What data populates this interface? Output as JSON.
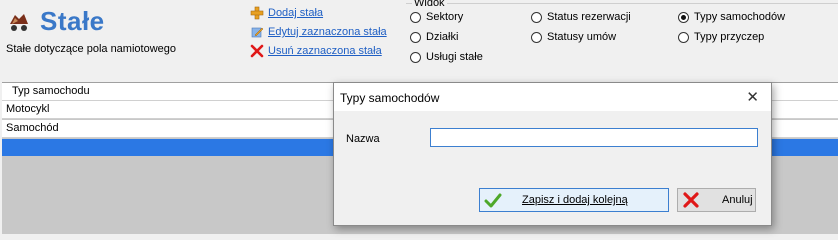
{
  "header": {
    "title": "Stałe",
    "subtitle": "Stałe dotyczące pola namiotowego"
  },
  "actions": {
    "add": "Dodaj stała",
    "edit": "Edytuj zaznaczona stała",
    "delete": "Usuń zaznaczona stała"
  },
  "view": {
    "label": "Widok",
    "options": [
      {
        "label": "Sektory",
        "checked": false
      },
      {
        "label": "Status rezerwacji",
        "checked": false
      },
      {
        "label": "Typy samochodów",
        "checked": true
      },
      {
        "label": "Działki",
        "checked": false
      },
      {
        "label": "Statusy umów",
        "checked": false
      },
      {
        "label": "Typy przyczep",
        "checked": false
      },
      {
        "label": "Usługi stałe",
        "checked": false
      }
    ]
  },
  "grid": {
    "column": "Typ samochodu",
    "rows": [
      "Motocykl",
      "Samochód"
    ]
  },
  "dialog": {
    "title": "Typy samochodów",
    "field_label": "Nazwa",
    "name_value": "",
    "save_label": "Zapisz i dodaj kolejną",
    "cancel_label": "Anuluj"
  },
  "colors": {
    "title": "#3a78c8",
    "link": "#1f5fc4",
    "selection": "#2b78e4"
  }
}
